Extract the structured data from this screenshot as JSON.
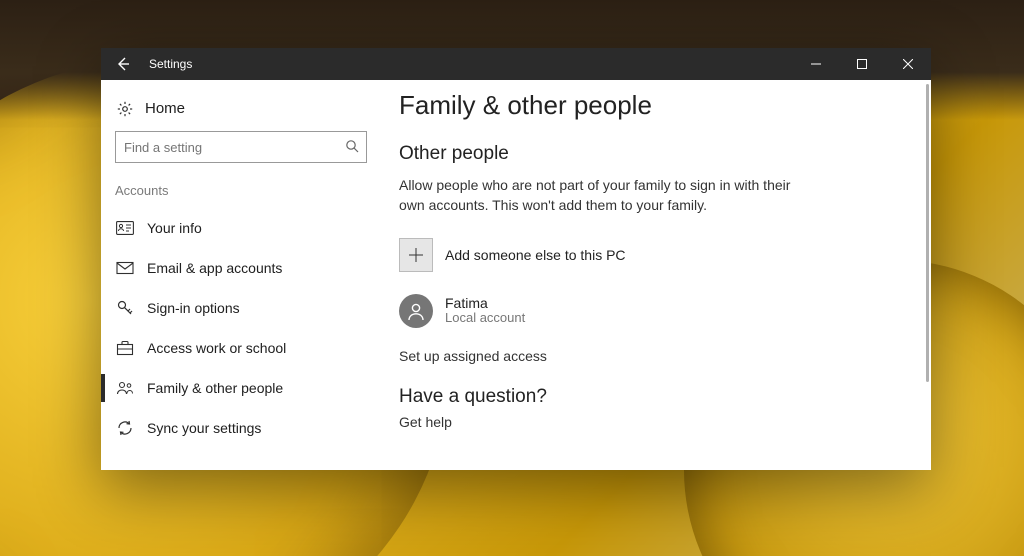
{
  "titlebar": {
    "title": "Settings"
  },
  "sidebar": {
    "home_label": "Home",
    "search_placeholder": "Find a setting",
    "section_label": "Accounts",
    "items": [
      {
        "id": "your-info",
        "label": "Your info"
      },
      {
        "id": "email-apps",
        "label": "Email & app accounts"
      },
      {
        "id": "sign-in",
        "label": "Sign-in options"
      },
      {
        "id": "work-school",
        "label": "Access work or school"
      },
      {
        "id": "family",
        "label": "Family & other people"
      },
      {
        "id": "sync",
        "label": "Sync your settings"
      }
    ]
  },
  "content": {
    "page_title": "Family & other people",
    "section_heading": "Other people",
    "description": "Allow people who are not part of your family to sign in with their own accounts. This won't add them to your family.",
    "add_label": "Add someone else to this PC",
    "user": {
      "name": "Fatima",
      "subtitle": "Local account"
    },
    "assigned_access_label": "Set up assigned access",
    "question_heading": "Have a question?",
    "help_link": "Get help"
  }
}
